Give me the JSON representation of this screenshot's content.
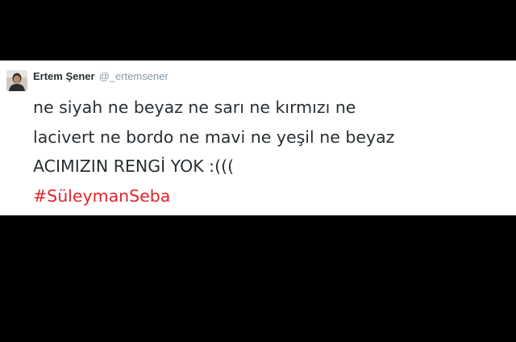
{
  "tweet": {
    "author_name": "Ertem Şener",
    "author_handle": "@_ertemsener",
    "lines": [
      "ne siyah ne beyaz ne sarı ne kırmızı ne",
      "lacivert ne bordo ne mavi ne yeşil ne beyaz",
      "ACIMIZIN RENGİ YOK :((("
    ],
    "hashtag": "#SüleymanSeba",
    "avatar_icon": "user-photo-icon"
  },
  "colors": {
    "background": "#000000",
    "card": "#ffffff",
    "text": "#292f33",
    "handle": "#8899a6",
    "hashtag": "#e0242b"
  }
}
